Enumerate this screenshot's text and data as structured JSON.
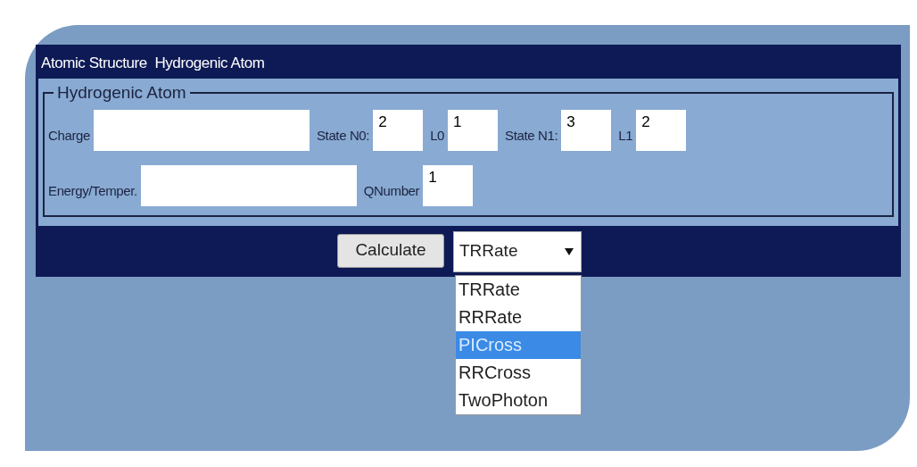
{
  "window": {
    "title": "Atomic Structure  Hydrogenic Atom"
  },
  "fieldset": {
    "legend": "Hydrogenic Atom",
    "rows": [
      [
        {
          "label": "Charge",
          "kind": "wide"
        },
        {
          "label": "State N0:",
          "kind": "narrow",
          "value": "2"
        },
        {
          "label": "L0",
          "kind": "narrow",
          "value": "1"
        },
        {
          "label": "State N1:",
          "kind": "narrow",
          "value": "3"
        },
        {
          "label": "L1",
          "kind": "narrow",
          "value": "2"
        }
      ],
      [
        {
          "label": "Energy/Temper.",
          "kind": "wide"
        },
        {
          "label": "QNumber",
          "kind": "narrow",
          "value": "1"
        }
      ]
    ]
  },
  "calculate_button": "Calculate",
  "select": {
    "value": "TRRate",
    "expanded": true,
    "options": [
      {
        "label": "TRRate",
        "highlighted": false
      },
      {
        "label": "RRRate",
        "highlighted": false
      },
      {
        "label": "PICross",
        "highlighted": true
      },
      {
        "label": "RRCross",
        "highlighted": false
      },
      {
        "label": "TwoPhoton",
        "highlighted": false
      }
    ]
  }
}
